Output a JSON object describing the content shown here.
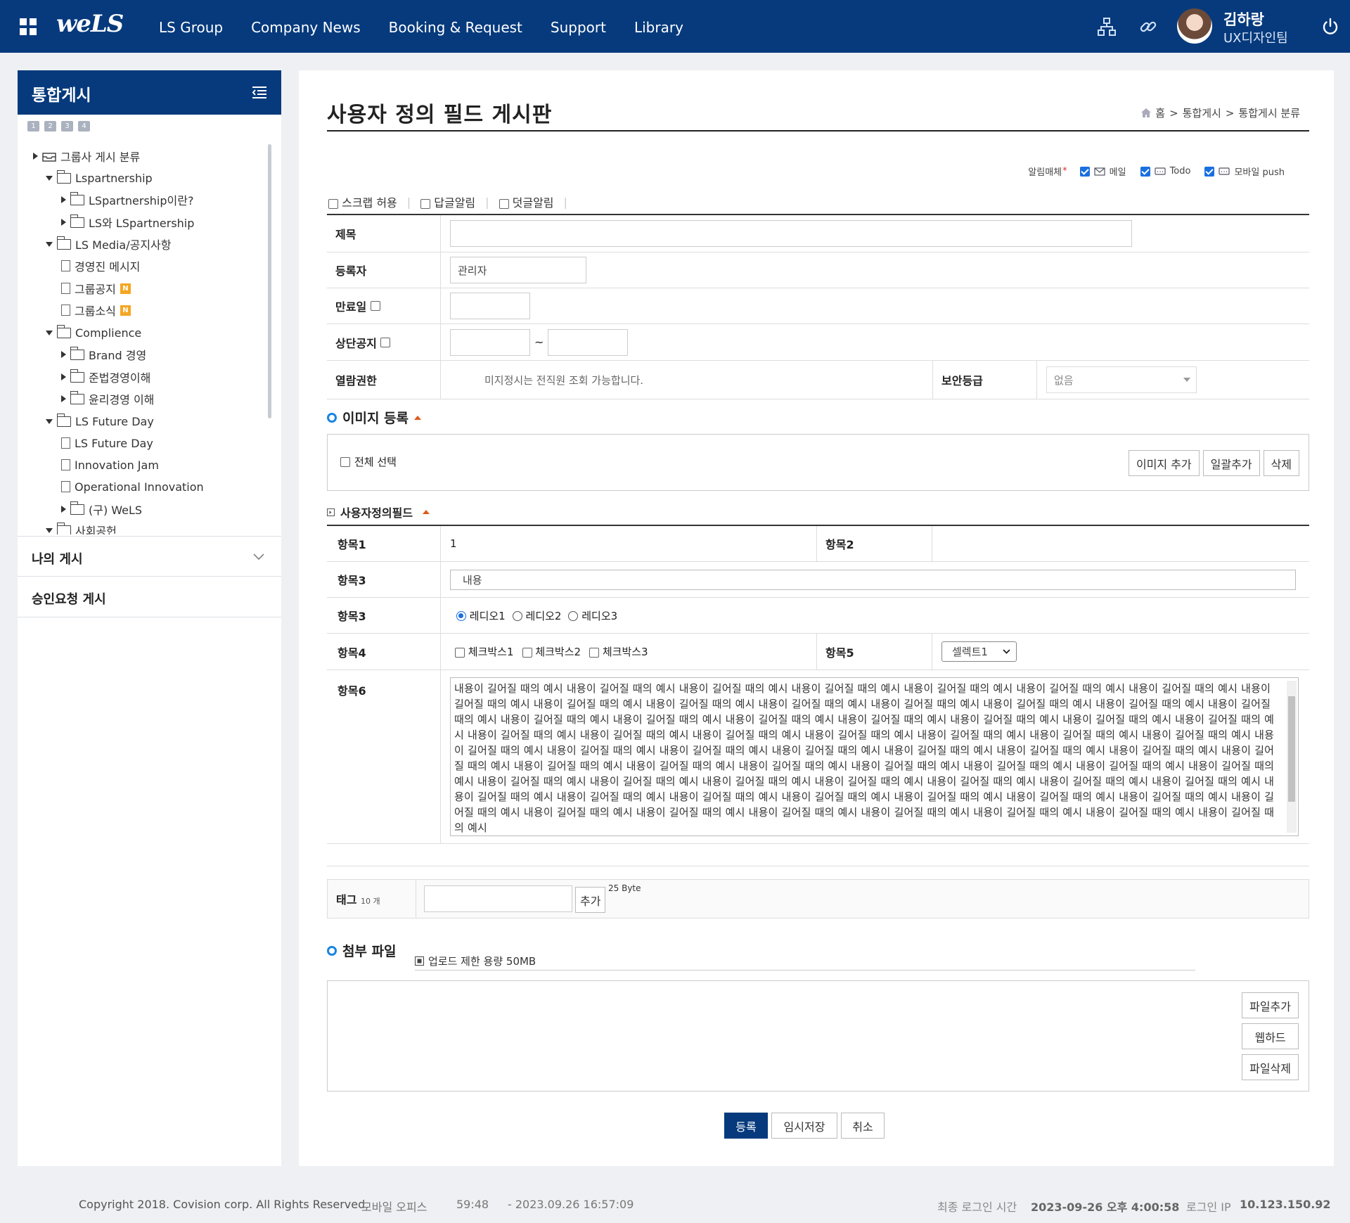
{
  "header": {
    "logo": "weLS",
    "nav": [
      "LS Group",
      "Company News",
      "Booking & Request",
      "Support",
      "Library"
    ],
    "user_name": "김하랑",
    "user_team": "UX디자인팀",
    "icons": [
      "apps-grid-icon",
      "org-chart-icon",
      "link-icon",
      "power-icon"
    ]
  },
  "sidebar": {
    "title": "통합게시",
    "pages": [
      "1",
      "2",
      "3",
      "4"
    ],
    "tree": [
      {
        "label": "그룹사 게시 분류",
        "type": "root"
      },
      {
        "label": "Lspartnership",
        "type": "folder-open"
      },
      {
        "label": "LSpartnership이란?",
        "type": "folder"
      },
      {
        "label": "LS와 LSpartnership",
        "type": "folder"
      },
      {
        "label": "LS Media/공지사항",
        "type": "folder-open"
      },
      {
        "label": "경영진 메시지",
        "type": "doc"
      },
      {
        "label": "그룹공지",
        "type": "doc",
        "badge": "N"
      },
      {
        "label": "그룹소식",
        "type": "doc",
        "badge": "N"
      },
      {
        "label": "Complience",
        "type": "folder-open"
      },
      {
        "label": "Brand 경영",
        "type": "folder"
      },
      {
        "label": "준법경영이해",
        "type": "folder"
      },
      {
        "label": "윤리경영 이해",
        "type": "folder"
      },
      {
        "label": "LS Future Day",
        "type": "folder-open"
      },
      {
        "label": "LS Future Day",
        "type": "doc"
      },
      {
        "label": "Innovation Jam",
        "type": "doc"
      },
      {
        "label": "Operational Innovation",
        "type": "doc"
      },
      {
        "label": "(구) WeLS",
        "type": "folder"
      },
      {
        "label": "사회공헌",
        "type": "folder-open"
      }
    ],
    "my_posts": "나의 게시",
    "approval_posts": "승인요청 게시"
  },
  "page": {
    "title": "사용자 정의 필드 게시판",
    "breadcrumb": [
      "홈",
      ">",
      "통합게시",
      ">",
      "통합게시 분류"
    ],
    "notify_label": "알림매체",
    "notify_required": "*",
    "notify_options": [
      "메일",
      "Todo",
      "모바일 push"
    ],
    "options": [
      "스크랩 허용",
      "답글알림",
      "덧글알림"
    ]
  },
  "form": {
    "subject_label": "제목",
    "author_label": "등록자",
    "author_value": "관리자",
    "expire_label": "만료일",
    "top_notice_label": "상단공지",
    "tilde": "~",
    "read_perm_label": "열람권한",
    "read_perm_value": "미지정시는 전직원 조회 가능합니다.",
    "security_label": "보안등급",
    "security_value": "없음"
  },
  "image_section": {
    "title": "이미지 등록",
    "select_all": "전체 선택",
    "buttons": [
      "이미지 추가",
      "일괄추가",
      "삭제"
    ]
  },
  "custom_fields": {
    "title": "사용자정의필드",
    "item1_label": "항목1",
    "item1_value": "1",
    "item2_label": "항목2",
    "item3_label": "항목3",
    "item3_value": "내용",
    "item3b_label": "항목3",
    "radios": [
      "레디오1",
      "레디오2",
      "레디오3"
    ],
    "item4_label": "항목4",
    "checkboxes": [
      "체크박스1",
      "체크박스2",
      "체크박스3"
    ],
    "item5_label": "항목5",
    "item5_value": "셀렉트1",
    "item6_label": "항목6",
    "item6_text": "내용이 길어질 때의 예시 내용이 길어질 때의 예시 내용이 길어질 때의 예시 내용이 길어질 때의 예시 내용이 길어질 때의 예시 내용이 길어질 때의 예시 내용이 길어질 때의 예시 내용이 길어질 때의 예시 내용이 길어질 때의 예시 내용이 길어질 때의 예시 내용이 길어질 때의 예시 내용이 길어질 때의 예시 내용이 길어질 때의 예시 내용이 길어질 때의 예시 내용이 길어질 때의 예시 내용이 길어질 때의 예시 내용이 길어질 때의 예시 내용이 길어질 때의 예시 내용이 길어질 때의 예시 내용이 길어질 때의 예시 내용이 길어질 때의 예시 내용이 길어질 때의 예시 내용이 길어질 때의 예시 내용이 길어질 때의 예시 내용이 길어질 때의 예시 내용이 길어질 때의 예시 내용이 길어질 때의 예시 내용이 길어질 때의 예시 내용이 길어질 때의 예시 내용이 길어질 때의 예시 내용이 길어질 때의 예시 내용이 길어질 때의 예시 내용이 길어질 때의 예시 내용이 길어질 때의 예시 내용이 길어질 때의 예시 내용이 길어질 때의 예시 내용이 길어질 때의 예시 내용이 길어질 때의 예시 내용이 길어질 때의 예시 내용이 길어질 때의 예시 내용이 길어질 때의 예시 내용이 길어질 때의 예시 내용이 길어질 때의 예시 내용이 길어질 때의 예시 내용이 길어질 때의 예시 내용이 길어질 때의 예시 내용이 길어질 때의 예시 내용이 길어질 때의 예시 내용이 길어질 때의 예시 내용이 길어질 때의 예시 내용이 길어질 때의 예시 내용이 길어질 때의 예시 내용이 길어질 때의 예시 내용이 길어질 때의 예시 내용이 길어질 때의 예시 내용이 길어질 때의 예시 내용이 길어질 때의 예시 내용이 길어질 때의 예시 내용이 길어질 때의 예시 내용이 길어질 때의 예시 내용이 길어질 때의 예시 내용이 길어질 때의 예시 내용이 길어질 때의 예시 내용이 길어질 때의 예시 내용이 길어질 때의 예시 내용이 길어질 때의 예시"
  },
  "tag": {
    "label": "태그",
    "count": "10 개",
    "add": "추가",
    "bytes": "25 Byte"
  },
  "attach": {
    "title": "첨부 파일",
    "limit": "업로드 제한 용량 50MB",
    "buttons": [
      "파일추가",
      "웹하드",
      "파일삭제"
    ]
  },
  "actions": [
    "등록",
    "임시저장",
    "취소"
  ],
  "footer": {
    "copyright": "Copyright 2018. Covision corp. All Rights Reserved.",
    "mobile_office": "모바일 오피스",
    "time": "59:48",
    "session": "- 2023.09.26 16:57:09",
    "last_login_label": "최종 로그인 시간",
    "last_login_value": "2023-09-26 오후 4:00:58",
    "ip_label": "로그인 IP",
    "ip_value": "10.123.150.92"
  },
  "colors": {
    "brand": "#063a7d",
    "accent": "#1a84e0",
    "caret": "#e05a1a",
    "badge": "#f5a623"
  }
}
